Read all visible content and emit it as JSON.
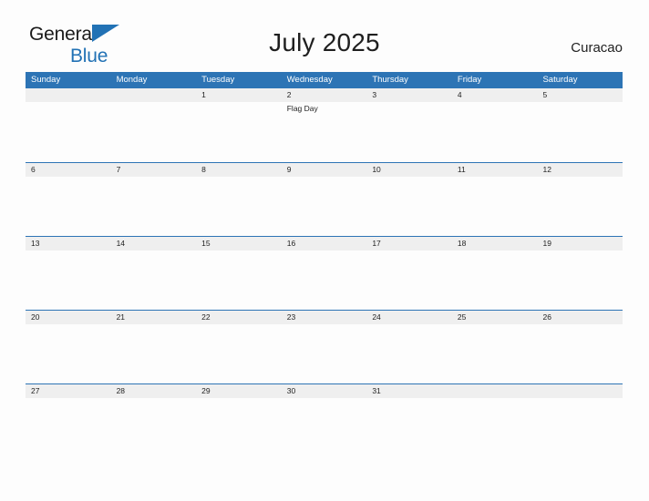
{
  "brand": {
    "name_part1": "General",
    "name_part2": "Blue",
    "triangle_icon": "blue-triangle-icon",
    "color_dark": "#1b1b1b",
    "color_blue": "#2272b5"
  },
  "header": {
    "title": "July 2025",
    "locale": "Curacao"
  },
  "theme": {
    "header_blue": "#2d74b5",
    "date_band_gray": "#efefef",
    "page_background": "#fdfdfd",
    "text_dark": "#1f1f1f"
  },
  "calendar": {
    "month": "July",
    "year": "2025",
    "weekdays": [
      "Sunday",
      "Monday",
      "Tuesday",
      "Wednesday",
      "Thursday",
      "Friday",
      "Saturday"
    ],
    "weeks": [
      [
        {
          "date": "",
          "events": []
        },
        {
          "date": "",
          "events": []
        },
        {
          "date": "1",
          "events": []
        },
        {
          "date": "2",
          "events": [
            "Flag Day"
          ]
        },
        {
          "date": "3",
          "events": []
        },
        {
          "date": "4",
          "events": []
        },
        {
          "date": "5",
          "events": []
        }
      ],
      [
        {
          "date": "6",
          "events": []
        },
        {
          "date": "7",
          "events": []
        },
        {
          "date": "8",
          "events": []
        },
        {
          "date": "9",
          "events": []
        },
        {
          "date": "10",
          "events": []
        },
        {
          "date": "11",
          "events": []
        },
        {
          "date": "12",
          "events": []
        }
      ],
      [
        {
          "date": "13",
          "events": []
        },
        {
          "date": "14",
          "events": []
        },
        {
          "date": "15",
          "events": []
        },
        {
          "date": "16",
          "events": []
        },
        {
          "date": "17",
          "events": []
        },
        {
          "date": "18",
          "events": []
        },
        {
          "date": "19",
          "events": []
        }
      ],
      [
        {
          "date": "20",
          "events": []
        },
        {
          "date": "21",
          "events": []
        },
        {
          "date": "22",
          "events": []
        },
        {
          "date": "23",
          "events": []
        },
        {
          "date": "24",
          "events": []
        },
        {
          "date": "25",
          "events": []
        },
        {
          "date": "26",
          "events": []
        }
      ],
      [
        {
          "date": "27",
          "events": []
        },
        {
          "date": "28",
          "events": []
        },
        {
          "date": "29",
          "events": []
        },
        {
          "date": "30",
          "events": []
        },
        {
          "date": "31",
          "events": []
        },
        {
          "date": "",
          "events": []
        },
        {
          "date": "",
          "events": []
        }
      ]
    ]
  }
}
